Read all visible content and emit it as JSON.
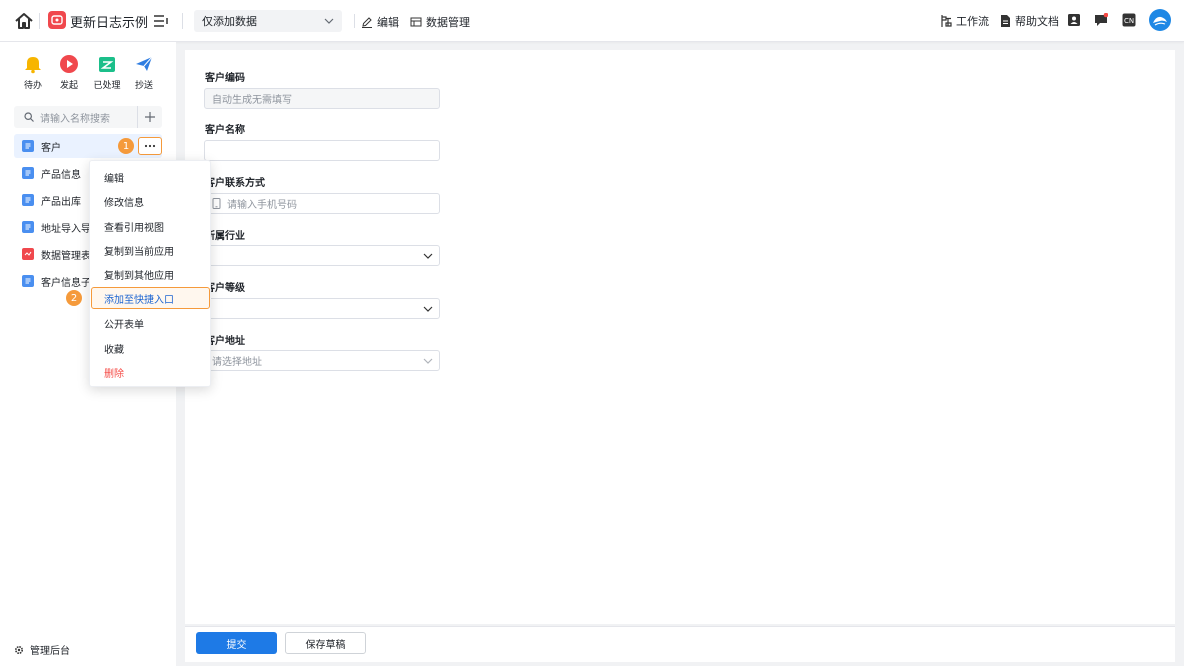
{
  "header": {
    "app_title": "更新日志示例",
    "view_select_value": "仅添加数据",
    "edit_label": "编辑",
    "data_manage_label": "数据管理",
    "workflow_label": "工作流",
    "help_label": "帮助文档",
    "lang_label": "CN"
  },
  "sidebar": {
    "quick_actions": [
      {
        "label": "待办",
        "icon": "bell-icon",
        "color": "#f7b500"
      },
      {
        "label": "发起",
        "icon": "play-icon",
        "color": "#f0484d"
      },
      {
        "label": "已处理",
        "icon": "done-icon",
        "color": "#1bbf8a"
      },
      {
        "label": "抄送",
        "icon": "send-icon",
        "color": "#2f7de1"
      }
    ],
    "search_placeholder": "请输入名称搜索",
    "items": [
      {
        "label": "客户"
      },
      {
        "label": "产品信息"
      },
      {
        "label": "产品出库"
      },
      {
        "label": "地址导入导出"
      },
      {
        "label": "数据管理表"
      },
      {
        "label": "客户信息子表"
      }
    ],
    "admin_label": "管理后台",
    "badge_1": "1",
    "badge_2": "2"
  },
  "context_menu": {
    "items": [
      "编辑",
      "修改信息",
      "查看引用视图",
      "复制到当前应用",
      "复制到其他应用",
      "添加至快捷入口",
      "公开表单",
      "收藏",
      "删除"
    ]
  },
  "form": {
    "fields": [
      {
        "label": "客户编码",
        "placeholder": "自动生成无需填写"
      },
      {
        "label": "客户名称",
        "placeholder": ""
      },
      {
        "label": "客户联系方式",
        "placeholder": "请输入手机号码"
      },
      {
        "label": "所属行业",
        "placeholder": ""
      },
      {
        "label": "客户等级",
        "placeholder": ""
      },
      {
        "label": "客户地址",
        "placeholder": "请选择地址"
      }
    ],
    "submit_label": "提交",
    "draft_label": "保存草稿"
  },
  "colors": {
    "primary": "#1e7ae6",
    "accent_orange": "#f59a3b",
    "danger": "#f54a45"
  }
}
